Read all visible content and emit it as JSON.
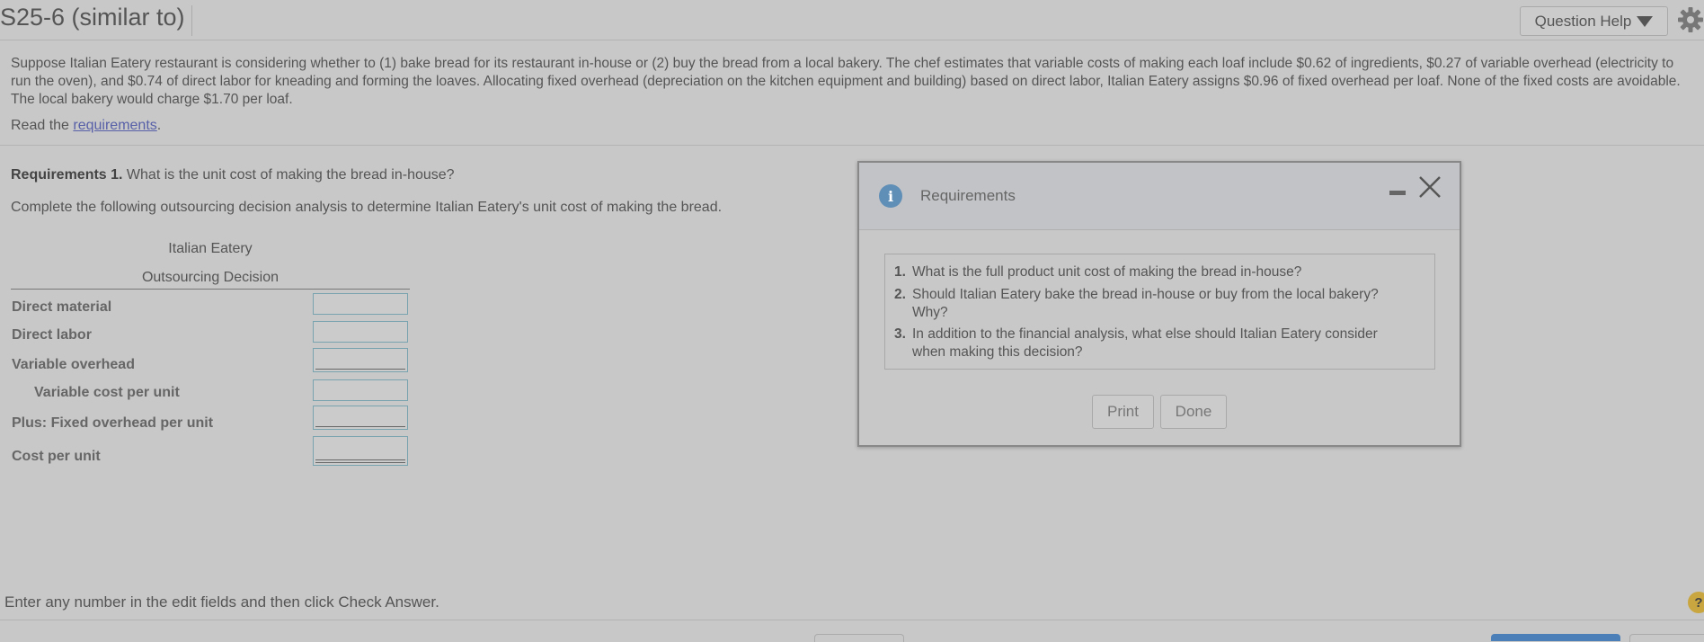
{
  "header": {
    "title": "S25-6 (similar to)",
    "question_help": "Question Help"
  },
  "problem": {
    "text": "Suppose Italian Eatery restaurant is considering whether to (1) bake bread for its restaurant in-house or (2) buy the bread from a local bakery. The chef estimates that variable costs of making each loaf include $0.62 of ingredients, $0.27 of variable overhead (electricity to run the oven), and $0.74 of direct labor for kneading and forming the loaves. Allocating fixed overhead (depreciation on the kitchen equipment and building) based on direct labor, Italian Eatery assigns $0.96 of fixed overhead per loaf. None of the fixed costs are avoidable. The local bakery would charge $1.70 per loaf.",
    "read_prefix": "Read the ",
    "read_link": "requirements",
    "read_suffix": "."
  },
  "question": {
    "req_label": "Requirements 1.",
    "req_text": " What is the unit cost of making the bread in-house?",
    "instruction": "Complete the following outsourcing decision analysis to determine Italian Eatery's unit cost of making the bread."
  },
  "table": {
    "company": "Italian Eatery",
    "subtitle": "Outsourcing Decision",
    "rows": [
      {
        "label": "Direct material",
        "value": ""
      },
      {
        "label": "Direct labor",
        "value": ""
      },
      {
        "label": "Variable overhead",
        "value": ""
      },
      {
        "label": "Variable cost per unit",
        "value": ""
      },
      {
        "label": "Plus: Fixed overhead per unit",
        "value": ""
      },
      {
        "label": "Cost per unit",
        "value": ""
      }
    ]
  },
  "modal": {
    "title": "Requirements",
    "items": [
      {
        "num": "1.",
        "line1": "What is the full product unit cost of making the bread in-house?",
        "line2": ""
      },
      {
        "num": "2.",
        "line1": "Should Italian Eatery bake the bread in-house or buy from the local bakery?",
        "line2": "Why?"
      },
      {
        "num": "3.",
        "line1": "In addition to the financial analysis, what else should Italian Eatery consider",
        "line2": "when making this decision?"
      }
    ],
    "print_label": "Print",
    "done_label": "Done"
  },
  "footer": {
    "text": "Enter any number in the edit fields and then click Check Answer.",
    "help_glyph": "?"
  },
  "colors": {
    "background": "#c8c8c8",
    "link": "#5860a8",
    "info_icon": "#5f8eb6",
    "help_icon": "#c9a640"
  }
}
